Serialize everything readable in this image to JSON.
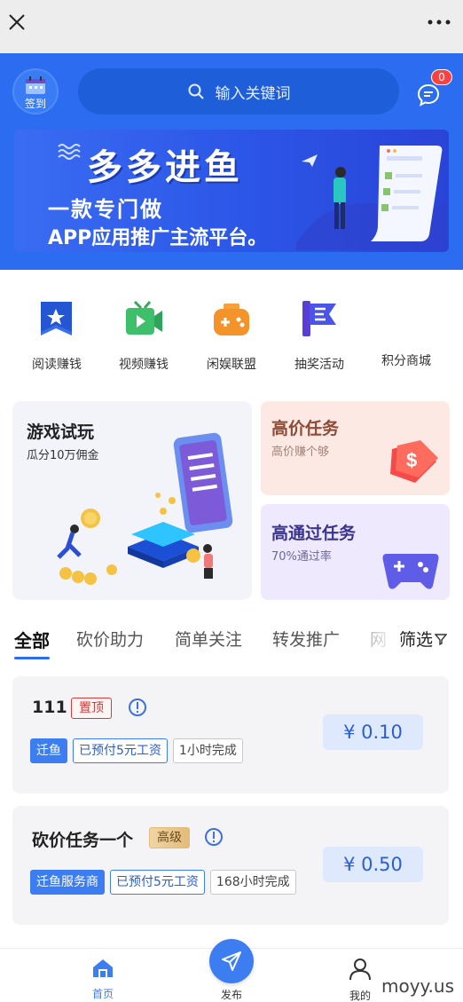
{
  "window": {
    "close_icon": "close-icon",
    "more_icon": "more-icon"
  },
  "header": {
    "signin_label": "签到",
    "search_placeholder": "输入关键词",
    "message_badge": "0",
    "accent_color": "#2b6cf0"
  },
  "banner": {
    "title": "多多进鱼",
    "line1": "一款专门做",
    "line2": "APP应用推广主流平台。"
  },
  "categories": [
    {
      "label": "阅读赚钱",
      "icon": "book-icon"
    },
    {
      "label": "视频赚钱",
      "icon": "video-icon"
    },
    {
      "label": "闲娱联盟",
      "icon": "gamepad-icon"
    },
    {
      "label": "抽奖活动",
      "icon": "flag-icon"
    },
    {
      "label": "积分商城",
      "icon": "mall-icon"
    }
  ],
  "promos": {
    "game": {
      "title": "游戏试玩",
      "subtitle": "瓜分10万佣金"
    },
    "high": {
      "title": "高价任务",
      "subtitle": "高价赚个够"
    },
    "pass": {
      "title": "高通过任务",
      "subtitle": "70%通过率"
    }
  },
  "tabs": {
    "items": [
      "全部",
      "砍价助力",
      "简单关注",
      "转发推广",
      "网"
    ],
    "active": "全部",
    "filter_label": "筛选"
  },
  "tasks": [
    {
      "name": "111",
      "badge": "置顶",
      "tags": [
        "迁鱼",
        "已预付5元工资",
        "1小时完成"
      ],
      "price": "¥ 0.10"
    },
    {
      "name": "砍价任务一个",
      "badge": "高级",
      "tags": [
        "迁鱼服务商",
        "已预付5元工资",
        "168小时完成"
      ],
      "price": "¥ 0.50"
    }
  ],
  "nav": {
    "home": "首页",
    "publish": "发布",
    "mine": "我的"
  },
  "watermark": "moyy.us"
}
